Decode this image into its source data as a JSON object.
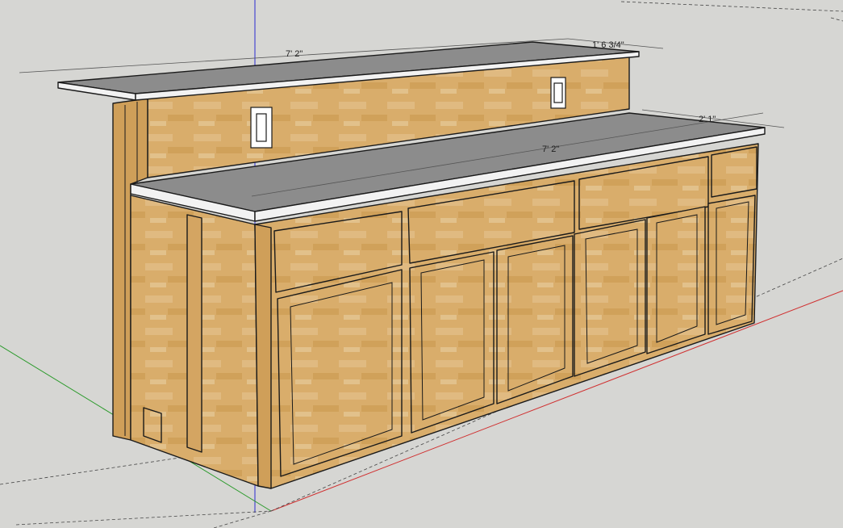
{
  "app": {
    "view": "3D model viewport"
  },
  "dimensions": {
    "upper_length": "7' 2\"",
    "upper_depth": "1' 6 3/4\"",
    "lower_length": "7' 2\"",
    "lower_depth": "2' 1\""
  },
  "colors": {
    "background": "#d6d6d3",
    "wood": "#d9ad6b",
    "wood_dark": "#c8964f",
    "counter_top": "#8c8c8c",
    "counter_edge": "#f2f2f2",
    "axis_red": "#d03030",
    "axis_green": "#2a9a2a",
    "axis_blue": "#2a2ad0"
  }
}
